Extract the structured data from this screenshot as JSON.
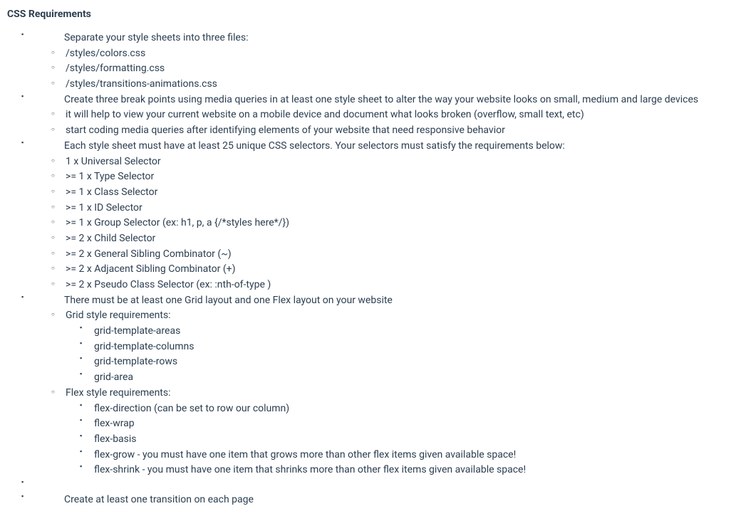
{
  "heading": "CSS Requirements",
  "items": [
    {
      "text": "Separate your style sheets into three files:",
      "children": [
        {
          "text": "/styles/colors.css"
        },
        {
          "text": "/styles/formatting.css"
        },
        {
          "text": "/styles/transitions-animations.css"
        }
      ]
    },
    {
      "text": "Create three break points using media queries in at least one style sheet to alter the way your website looks on small, medium and large devices",
      "children": [
        {
          "text": "it will help to view your current website on a mobile device and document what looks broken (overflow, small text, etc)"
        },
        {
          "text": "start coding media queries after identifying elements of your website that need responsive behavior"
        }
      ]
    },
    {
      "text": "Each style sheet must have at least 25 unique CSS selectors. Your selectors must satisfy the requirements below:",
      "children": [
        {
          "text": "1 x Universal Selector"
        },
        {
          "text": ">= 1 x Type Selector"
        },
        {
          "text": ">= 1 x Class Selector"
        },
        {
          "text": ">= 1 x ID Selector"
        },
        {
          "text": ">= 1 x Group Selector (ex: h1, p, a {/*styles here*/})"
        },
        {
          "text": ">= 2 x Child Selector"
        },
        {
          "text": ">= 2 x General Sibling Combinator (~)"
        },
        {
          "text": ">= 2 x Adjacent Sibling Combinator (+)"
        },
        {
          "text": ">= 2 x Pseudo Class Selector (ex: :nth-of-type )"
        }
      ]
    },
    {
      "text": "There must be at least one Grid layout and one Flex layout on your website",
      "children": [
        {
          "text": "Grid style requirements:",
          "children": [
            {
              "text": "grid-template-areas"
            },
            {
              "text": "grid-template-columns"
            },
            {
              "text": "grid-template-rows"
            },
            {
              "text": "grid-area"
            }
          ]
        },
        {
          "text": "Flex style requirements:",
          "children": [
            {
              "text": "flex-direction (can be set to row our column)"
            },
            {
              "text": "flex-wrap"
            },
            {
              "text": "flex-basis"
            },
            {
              "text": "flex-grow - you must have one item that grows more than other flex items given available space!"
            },
            {
              "text": "flex-shrink - you must have one item that shrinks more than other flex items given available space!"
            }
          ]
        }
      ]
    },
    {
      "text": "",
      "empty": true
    },
    {
      "text": "Create at least one transition on each page"
    }
  ]
}
